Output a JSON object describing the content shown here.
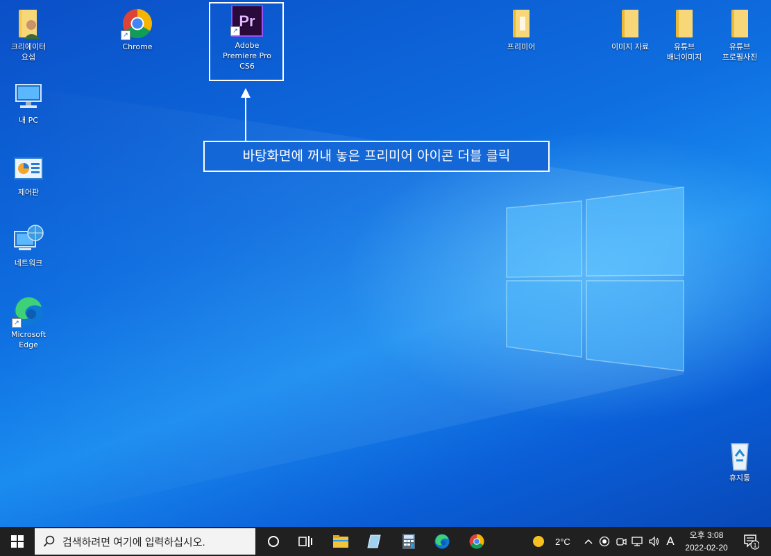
{
  "desktop_icons": {
    "creator_folder": "크리에이터\n요섭",
    "chrome": "Chrome",
    "premiere": "Adobe\nPremiere Pro\nCS6",
    "premiere_glyph": "Pr",
    "premiere_folder": "프리미어",
    "image_folder": "이미지 자료",
    "youtube_banner_folder": "유튜브\n배너이미지",
    "youtube_profile_folder": "유튜브\n프로필사진",
    "my_pc": "내 PC",
    "control_panel": "제어판",
    "network": "네트워크",
    "edge": "Microsoft\nEdge",
    "recycle_bin": "휴지통"
  },
  "callout": {
    "text": "바탕화면에 꺼내 놓은 프리미어 아이콘 더블 클릭"
  },
  "taskbar": {
    "search_placeholder": "검색하려면 여기에 입력하십시오.",
    "weather_temp": "2°C",
    "ime_indicator": "A",
    "clock_time": "오후 3:08",
    "clock_date": "2022-02-20",
    "notification_count": "1"
  },
  "icons": [
    "windows-start-icon",
    "search-icon",
    "cortana-icon",
    "task-view-icon",
    "file-explorer-icon",
    "notepad-icon",
    "calculator-icon",
    "edge-icon",
    "chrome-icon",
    "weather-sun-icon",
    "chevron-up-icon",
    "record-icon",
    "meet-icon",
    "network-icon",
    "volume-icon",
    "notification-icon"
  ]
}
